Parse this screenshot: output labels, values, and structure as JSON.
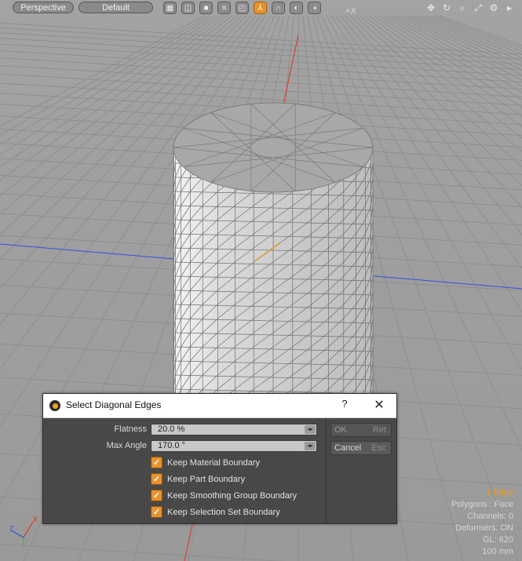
{
  "toolbar": {
    "view_mode": "Perspective",
    "shading": "Default",
    "axis_label": "+X",
    "icons": [
      "grid-icon",
      "wireframe-icon",
      "solid-icon",
      "texture-icon",
      "layout-icon",
      "axis-icon",
      "curve-icon",
      "reflect-icon"
    ]
  },
  "stats": {
    "selection": "1 Edge",
    "polygons": "Polygons : Face",
    "channels": "Channels: 0",
    "deformers": "Deformers: ON",
    "gl": "GL: 620",
    "size": "100 mm"
  },
  "dialog": {
    "title": "Select Diagonal Edges",
    "help": "?",
    "flatness_label": "Flatness",
    "flatness_value": "20.0 %",
    "max_angle_label": "Max Angle",
    "max_angle_value": "170.0 °",
    "checkboxes": [
      {
        "label": "Keep Material Boundary",
        "checked": true
      },
      {
        "label": "Keep Part Boundary",
        "checked": true
      },
      {
        "label": "Keep Smoothing Group Boundary",
        "checked": true
      },
      {
        "label": "Keep Selection Set Boundary",
        "checked": true
      }
    ],
    "ok_label": "OK",
    "ok_key": "Ret",
    "cancel_label": "Cancel",
    "cancel_key": "Esc"
  },
  "colors": {
    "accent": "#e8922a",
    "grid_axis_x": "#3050e0",
    "grid_axis_y": "#e03020",
    "selected_edge": "#f0a020"
  }
}
